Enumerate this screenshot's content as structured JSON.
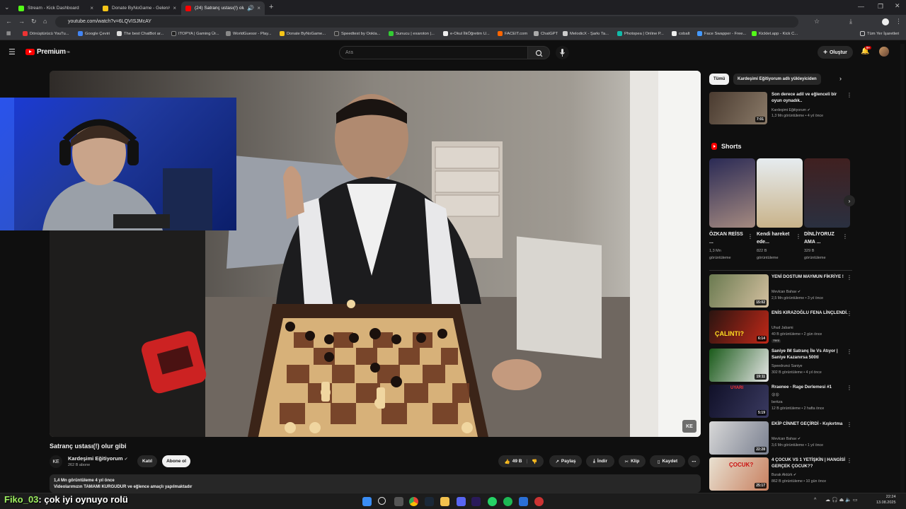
{
  "browser": {
    "tabs": [
      {
        "title": "Stream - Kick Dashboard",
        "color": "#53fc18"
      },
      {
        "title": "Donate ByNoGame - Gelen/Gi...",
        "color": "#f5c518"
      },
      {
        "title": "(24) Satranç ustası(!) olur g...",
        "color": "#ff0000"
      }
    ],
    "url": "youtube.com/watch?v=6LQVISJMcAY",
    "bookmarks": [
      "Dönüştürücü YouTu...",
      "Google Çeviri",
      "The best ChatBot ar...",
      "ITOPYA | Gaming Ür...",
      "WorldGuessr - Play...",
      "Donate ByNoGame...",
      "Speedtest by Ookla...",
      "Sunucu | exaroton |...",
      "e-Okul İlkÖğretim U...",
      "FACEIT.com",
      "ChatGPT",
      "MelodicX - Şarkı Ta...",
      "Photopea | Online P...",
      "cobalt",
      "Face Swapper - Free...",
      "Kicklet.app - Kick C..."
    ],
    "all_bookmarks": "Tüm Yer İşaretleri"
  },
  "youtube": {
    "logo": "Premium",
    "logo_sup": "TR",
    "search_placeholder": "Ara",
    "create_label": "Oluştur",
    "notif_count": "9+"
  },
  "video": {
    "title": "Satranç ustası(!) olur gibi",
    "channel": "Kardeşimi Eğitiyorum",
    "channel_initials": "KE",
    "subs": "262 B abone",
    "join": "Katıl",
    "subscribe": "Abone ol",
    "likes": "49 B",
    "share": "Paylaş",
    "download": "İndir",
    "clip": "Klip",
    "save": "Kaydet",
    "views_line": "1,4 Mn görüntüleme  4 yıl önce",
    "desc_line": "Videolarımızın TAMAMI KURGUDUR ve eğlence amaçlı yapılmaktadır",
    "player_logo": "KE"
  },
  "chips": [
    "Tümü",
    "Kardeşimi Eğitiyorum adlı yükleyiciden"
  ],
  "top_rec": {
    "title": "Son derece adil ve eğlenceli bir oyun oynadık..",
    "channel": "Kardeşimi Eğitiyorum",
    "meta": "1,3 Mn görüntüleme • 4 yıl önce",
    "dur": "7:01"
  },
  "shorts": {
    "header": "Shorts",
    "items": [
      {
        "title": "ÖZKAN REİSS ...",
        "views": "1,3 Mn",
        "suffix": "görüntüleme"
      },
      {
        "title": "Kendi hareket ede...",
        "views": "822 B",
        "suffix": "görüntüleme"
      },
      {
        "title": "DİNLİYORUZ AMA ...",
        "views": "329 B",
        "suffix": "görüntüleme"
      }
    ]
  },
  "recs": [
    {
      "title": "YENİ DOSTUM MAYMUN FİKRİYE !",
      "channel": "Mevlcan Bahav",
      "meta": "2,5 Mn görüntüleme • 3 yıl önce",
      "dur": "15:02",
      "badge": ""
    },
    {
      "title": "ENİS KIRAZOĞLU FENA LİNÇLENDİ.",
      "channel": "Uhud Jabami",
      "meta": "40 B görüntüleme • 2 gün önce",
      "dur": "6:14",
      "badge": "Yeni"
    },
    {
      "title": "Saniye IM Satranç İle Vs Atıyor | Saniye Kazanırsa 500tl",
      "channel": "Speedrunci Saniye",
      "meta": "302 B görüntüleme • 4 yıl önce",
      "dur": "19:11",
      "badge": ""
    },
    {
      "title": "Rraenee - Rage Derlemesi #1",
      "channel": "berkza",
      "meta": "12 B görüntüleme • 2 hafta önce",
      "dur": "5:19",
      "badge": ""
    },
    {
      "title": "EKİP CİNNET GEÇİRDİ - Kışkırtma",
      "channel": "Mevlcan Bahav",
      "meta": "3,6 Mn görüntüleme • 1 yıl önce",
      "dur": "22:28",
      "badge": ""
    },
    {
      "title": "4 ÇOCUK VS 1 YETİŞKİN | HANGİSİ GERÇEK ÇOCUK??",
      "channel": "Burak Aktürk",
      "meta": "862 B görüntüleme • 10 gün önce",
      "dur": "25:17",
      "badge": ""
    }
  ],
  "overlay": {
    "chat_user": "Fiko_03",
    "chat_msg": ": çok iyi oynuyo rolü"
  },
  "taskbar": {
    "time": "22:24",
    "date": "13.08.2025"
  },
  "colors": {
    "accent_red": "#ff0000",
    "bg": "#0f0f0f",
    "surface": "#272727"
  }
}
